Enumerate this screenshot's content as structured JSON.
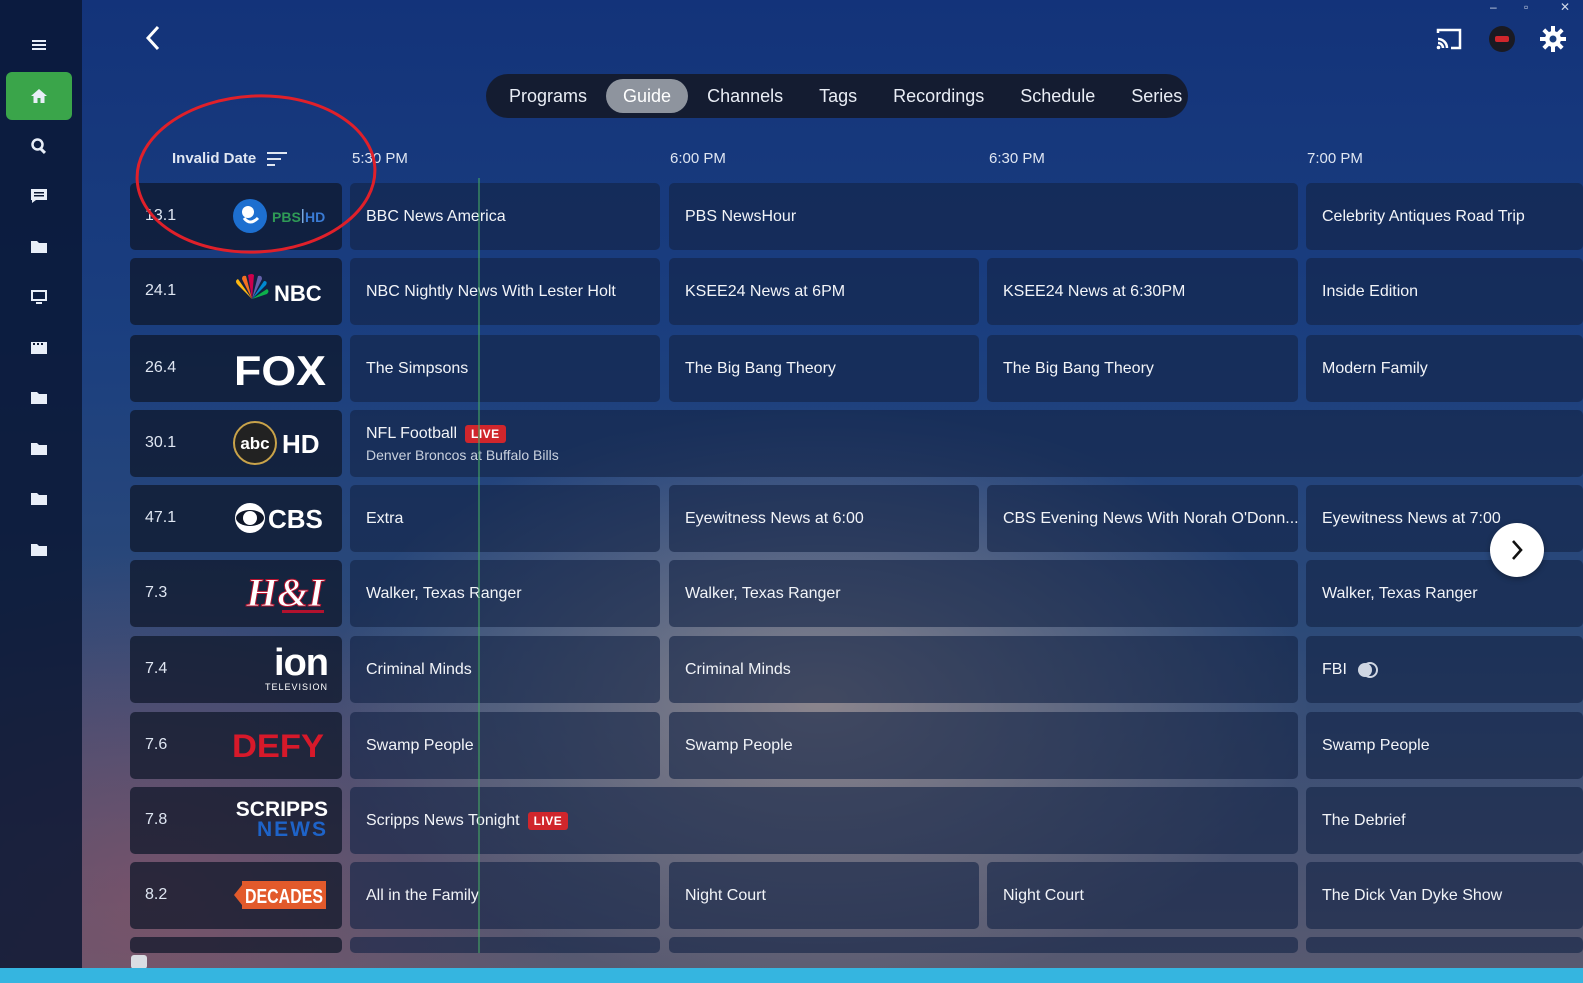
{
  "window": {
    "minimize": "–",
    "maximize": "▫",
    "close": "✕"
  },
  "sidebar": {
    "items": [
      {
        "icon": "menu-icon"
      },
      {
        "icon": "home-icon",
        "active": true
      },
      {
        "icon": "search-icon"
      },
      {
        "icon": "messages-icon"
      },
      {
        "icon": "folder-icon"
      },
      {
        "icon": "tv-icon"
      },
      {
        "icon": "movie-icon"
      },
      {
        "icon": "folder-icon"
      },
      {
        "icon": "folder-icon"
      },
      {
        "icon": "folder-icon"
      },
      {
        "icon": "folder-icon"
      }
    ]
  },
  "tabs": [
    {
      "label": "Programs"
    },
    {
      "label": "Guide",
      "active": true
    },
    {
      "label": "Channels"
    },
    {
      "label": "Tags"
    },
    {
      "label": "Recordings"
    },
    {
      "label": "Schedule"
    },
    {
      "label": "Series"
    }
  ],
  "guide": {
    "date_label": "Invalid Date",
    "times": [
      "5:30 PM",
      "6:00 PM",
      "6:30 PM",
      "7:00 PM"
    ],
    "live_label": "LIVE",
    "rows": [
      {
        "number": "13.1",
        "logo": "PBS HD",
        "programs": [
          {
            "title": "BBC News America"
          },
          {
            "title": "PBS NewsHour"
          },
          {
            "title": "Celebrity Antiques Road Trip"
          }
        ]
      },
      {
        "number": "24.1",
        "logo": "NBC",
        "programs": [
          {
            "title": "NBC Nightly News With Lester Holt"
          },
          {
            "title": "KSEE24 News at 6PM"
          },
          {
            "title": "KSEE24 News at 6:30PM"
          },
          {
            "title": "Inside Edition"
          }
        ]
      },
      {
        "number": "26.4",
        "logo": "FOX",
        "programs": [
          {
            "title": "The Simpsons"
          },
          {
            "title": "The Big Bang Theory"
          },
          {
            "title": "The Big Bang Theory"
          },
          {
            "title": "Modern Family"
          }
        ]
      },
      {
        "number": "30.1",
        "logo": "abc HD",
        "programs": [
          {
            "title": "NFL Football",
            "subtitle": "Denver Broncos at Buffalo Bills",
            "live": true
          }
        ]
      },
      {
        "number": "47.1",
        "logo": "CBS",
        "programs": [
          {
            "title": "Extra"
          },
          {
            "title": "Eyewitness News at 6:00"
          },
          {
            "title": "CBS Evening News With Norah O'Donn..."
          },
          {
            "title": "Eyewitness News at 7:00"
          }
        ]
      },
      {
        "number": "7.3",
        "logo": "H&I",
        "programs": [
          {
            "title": "Walker, Texas Ranger"
          },
          {
            "title": "Walker, Texas Ranger"
          },
          {
            "title": "Walker, Texas Ranger"
          }
        ]
      },
      {
        "number": "7.4",
        "logo_main": "ion",
        "logo_sub": "TELEVISION",
        "programs": [
          {
            "title": "Criminal Minds"
          },
          {
            "title": "Criminal Minds"
          },
          {
            "title": "FBI"
          }
        ]
      },
      {
        "number": "7.6",
        "logo": "DEFY",
        "programs": [
          {
            "title": "Swamp People"
          },
          {
            "title": "Swamp People"
          },
          {
            "title": "Swamp People"
          }
        ]
      },
      {
        "number": "7.8",
        "logo_main": "SCRIPPS",
        "logo_sub": "NEWS",
        "programs": [
          {
            "title": "Scripps News Tonight",
            "live": true
          },
          {
            "title": "The Debrief"
          }
        ]
      },
      {
        "number": "8.2",
        "logo": "DECADES",
        "programs": [
          {
            "title": "All in the Family"
          },
          {
            "title": "Night Court"
          },
          {
            "title": "Night Court"
          },
          {
            "title": "The Dick Van Dyke Show"
          }
        ]
      }
    ]
  },
  "colors": {
    "accent": "#3aa54a",
    "live": "#d0262c",
    "annotation": "#e0202a"
  }
}
